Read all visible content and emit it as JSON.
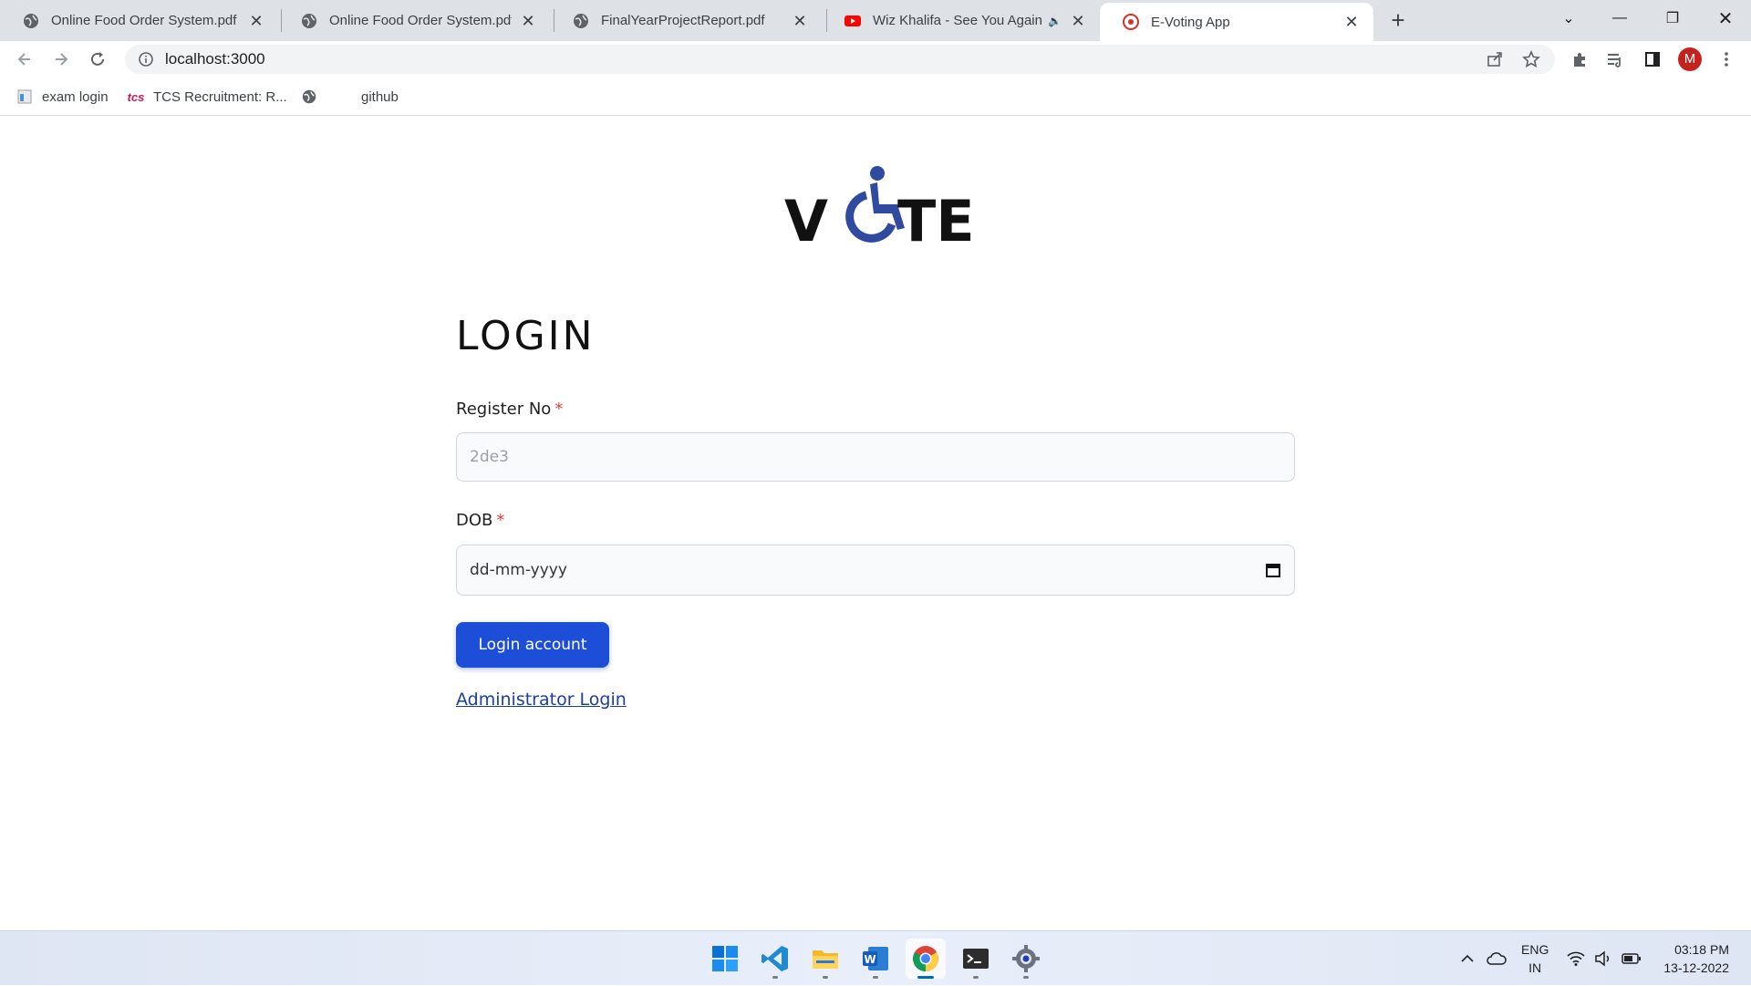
{
  "browser": {
    "tabs": [
      {
        "title": "Online Food Order System.pdf",
        "icon": "globe-icon"
      },
      {
        "title": "Online Food Order System.pdf",
        "icon": "globe-icon"
      },
      {
        "title": "FinalYearProjectReport.pdf",
        "icon": "globe-icon"
      },
      {
        "title": "Wiz Khalifa - See You Again f",
        "icon": "youtube-icon"
      },
      {
        "title": "E-Voting App",
        "icon": "app-favicon",
        "active": true
      }
    ],
    "url": "localhost:3000",
    "profile_initial": "M",
    "bookmarks": [
      {
        "label": "exam login"
      },
      {
        "label": "TCS Recruitment: R..."
      },
      {
        "label": ""
      },
      {
        "label": "github"
      }
    ]
  },
  "page": {
    "logo_text_left": "V",
    "logo_text_right": "TE",
    "title": "LOGIN",
    "fields": [
      {
        "label": "Register No",
        "required_mark": "*",
        "value": "2de3"
      },
      {
        "label": "DOB",
        "required_mark": "*",
        "value": "dd-mm-yyyy"
      }
    ],
    "submit_label": "Login account",
    "admin_link": "Administrator Login"
  },
  "taskbar": {
    "language": "ENG",
    "region": "IN",
    "time": "03:18 PM",
    "date": "13-12-2022"
  },
  "colors": {
    "primary_button": "#1d4ed8",
    "logo_accent": "#2f4a9e",
    "required": "#e53935"
  }
}
